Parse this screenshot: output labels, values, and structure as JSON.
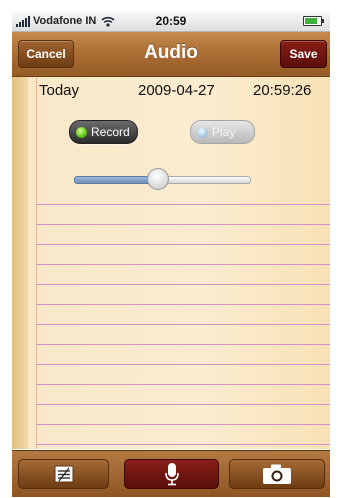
{
  "status_bar": {
    "carrier": "Vodafone IN",
    "time": "20:59",
    "signal_icon": "signal-bars-icon",
    "wifi_icon": "wifi-icon",
    "battery_icon": "battery-icon",
    "battery_level": 0.8
  },
  "nav": {
    "title": "Audio",
    "cancel_label": "Cancel",
    "save_label": "Save"
  },
  "entry": {
    "day": "Today",
    "date": "2009-04-27",
    "time": "20:59:26"
  },
  "controls": {
    "record_label": "Record",
    "play_label": "Play",
    "playback_position": 0.47
  },
  "toolbar": {
    "items": [
      {
        "icon": "notes-edit-icon"
      },
      {
        "icon": "microphone-icon"
      },
      {
        "icon": "camera-icon"
      }
    ]
  },
  "colors": {
    "nav_brown": "#a76a31",
    "save_red": "#6e1410",
    "paper": "#fbecd0",
    "rule_line": "#d990c8",
    "record_green": "#5cc21b"
  }
}
